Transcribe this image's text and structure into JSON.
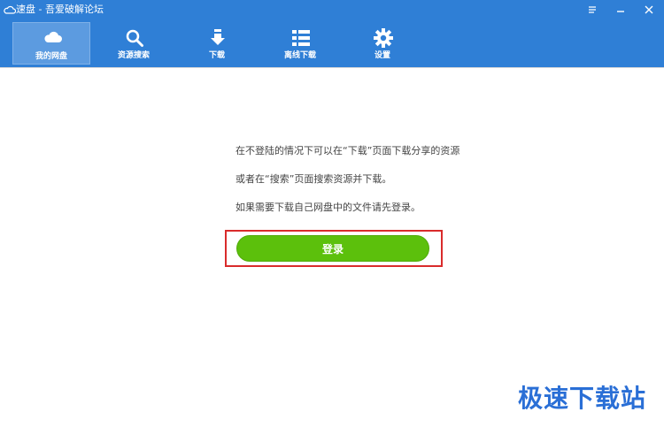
{
  "window": {
    "title": "速盘 - 吾爱破解论坛",
    "controls": [
      "menu-icon",
      "minimize-icon",
      "close-icon"
    ]
  },
  "toolbar": {
    "items": [
      {
        "label": "我的网盘",
        "icon": "cloud-icon",
        "active": true
      },
      {
        "label": "资源搜索",
        "icon": "search-icon",
        "active": false
      },
      {
        "label": "下载",
        "icon": "download-icon",
        "active": false
      },
      {
        "label": "离线下载",
        "icon": "list-icon",
        "active": false
      },
      {
        "label": "设置",
        "icon": "gear-icon",
        "active": false
      }
    ]
  },
  "main": {
    "messages": [
      "在不登陆的情况下可以在“下载”页面下载分享的资源",
      "或者在“搜索”页面搜索资源并下载。",
      "如果需要下载自己网盘中的文件请先登录。"
    ],
    "login_label": "登录"
  },
  "watermark": "极速下载站",
  "colors": {
    "toolbar": "#2f7fd6",
    "login_button": "#5cc00c",
    "highlight": "#d92b2b",
    "watermark": "#2a6fd6"
  }
}
